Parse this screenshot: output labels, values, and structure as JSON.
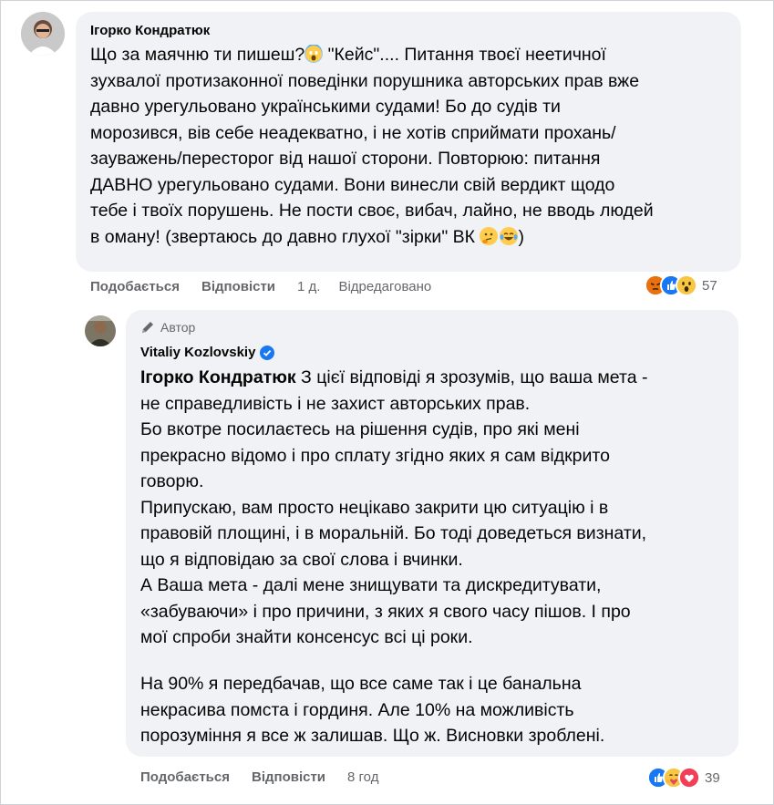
{
  "comment1": {
    "author": "Ігорко Кондратюк",
    "text_part1": "Що за маячню ти пишеш?",
    "text_part2": " \"Кейс\".... Питання твоєї неетичної\nзухвалої протизаконної поведінки порушника авторських прав вже\nдавно урегульовано українськими судами! Бо до судів ти\nморозився, вів себе неадекватно, і не хотів сприймати прохань/\nзауважень/пересторог від нашої сторони. Повторюю: питання\nДАВНО урегульовано судами. Вони винесли свій вердикт щодо\nтебе і твоїх порушень. Не пости своє, вибач, лайно, не вводь людей\nв оману! (звертаюсь до давно глухої \"зірки\" ВК ",
    "text_part3": ")",
    "emojis_inline": [
      "face-screaming-emoji",
      "thinking-face-emoji",
      "tears-of-joy-emoji"
    ],
    "like_label": "Подобається",
    "reply_label": "Відповісти",
    "time": "1 д.",
    "edited": "Відредаговано",
    "reactions": [
      "angry-reaction-icon",
      "like-reaction-icon",
      "wow-reaction-icon"
    ],
    "reaction_count": "57"
  },
  "comment2": {
    "author_badge": "Автор",
    "author": "Vitaliy Kozlovskiy",
    "mention": "Ігорко Кондратюк",
    "para1": " З цієї відповіді я зрозумів, що ваша мета -\nне справедливість і не захист авторських прав.\nБо вкотре посилаєтесь на рішення судів, про які мені\nпрекрасно відомо і про сплату згідно яких я сам відкрито\nговорю.\nПрипускаю, вам просто нецікаво закрити цю ситуацію і в\nправовій площині, і в моральній. Бо тоді доведеться визнати,\nщо я відповідаю за свої слова і вчинки.\nА Ваша мета - далі мене знищувати та дискредитувати,\n«забуваючи» і про причини, з яких я свого часу пішов. І про\nмої спроби знайти консенсус всі ці роки.",
    "para2": "На 90% я передбачав, що все саме так і це банальна\nнекрасива помста і гординя. Але 10% на можливість\nпорозуміння я все ж залишав. Що ж. Висновки зроблені.",
    "like_label": "Подобається",
    "reply_label": "Відповісти",
    "time": "8 год",
    "reactions": [
      "like-reaction-icon",
      "care-reaction-icon",
      "love-reaction-icon"
    ],
    "reaction_count": "39"
  },
  "colors": {
    "bubble": "#f0f2f5",
    "secondary_text": "#65676b",
    "verified_blue": "#1877f2"
  }
}
